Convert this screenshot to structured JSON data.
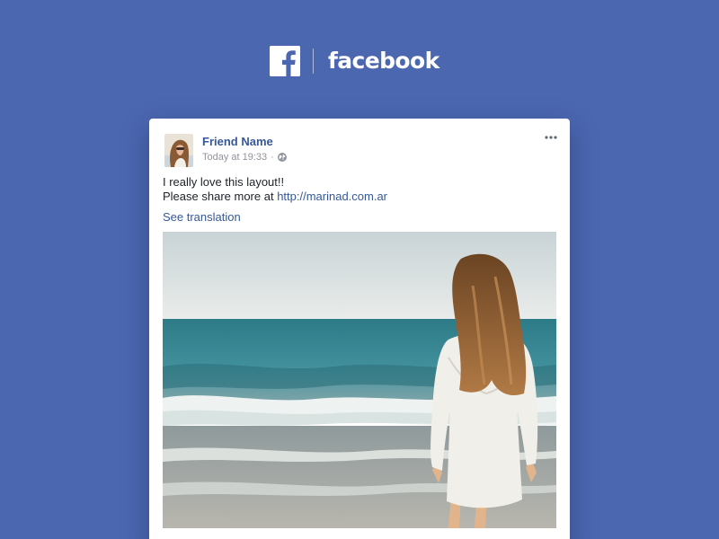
{
  "brand": {
    "wordmark": "facebook",
    "logo_icon": "facebook-f-icon",
    "background_color": "#4b67b0"
  },
  "post": {
    "author_name": "Friend Name",
    "timestamp": "Today at 19:33",
    "separator": "·",
    "privacy_icon": "globe-icon",
    "options_icon": "more-options-icon",
    "text_line_1": "I really love this layout!!",
    "text_line_2_prefix": "Please share more at ",
    "text_line_2_link": "http://marinad.com.ar",
    "see_translation": "See translation",
    "author_color": "#365899",
    "link_color": "#365899"
  }
}
